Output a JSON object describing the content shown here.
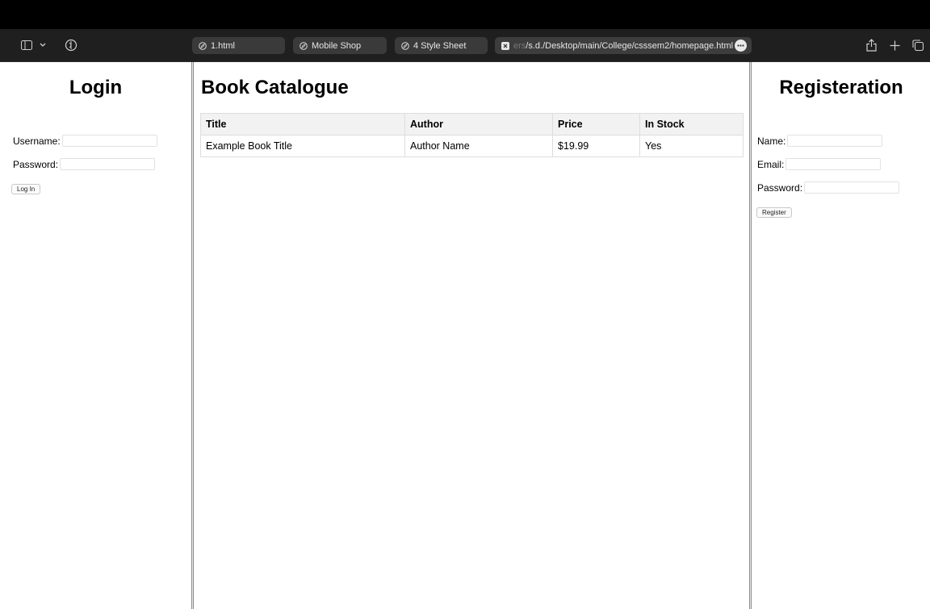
{
  "browser": {
    "tabs": [
      {
        "label": "1.html",
        "icon": "compass-icon"
      },
      {
        "label": "Mobile Shop",
        "icon": "compass-icon"
      },
      {
        "label": "4 Style Sheet",
        "icon": "compass-icon"
      }
    ],
    "active_tab": {
      "url_prefix": "ers",
      "url": "/s.d./Desktop/main/College/csssem2/homepage.html"
    }
  },
  "login": {
    "title": "Login",
    "username_label": "Username:",
    "password_label": "Password:",
    "button_label": "Log In"
  },
  "catalogue": {
    "title": "Book Catalogue",
    "columns": [
      "Title",
      "Author",
      "Price",
      "In Stock"
    ],
    "rows": [
      [
        "Example Book Title",
        "Author Name",
        "$19.99",
        "Yes"
      ]
    ]
  },
  "registration": {
    "title": "Registeration",
    "name_label": "Name:",
    "email_label": "Email:",
    "password_label": "Password:",
    "button_label": "Register"
  }
}
